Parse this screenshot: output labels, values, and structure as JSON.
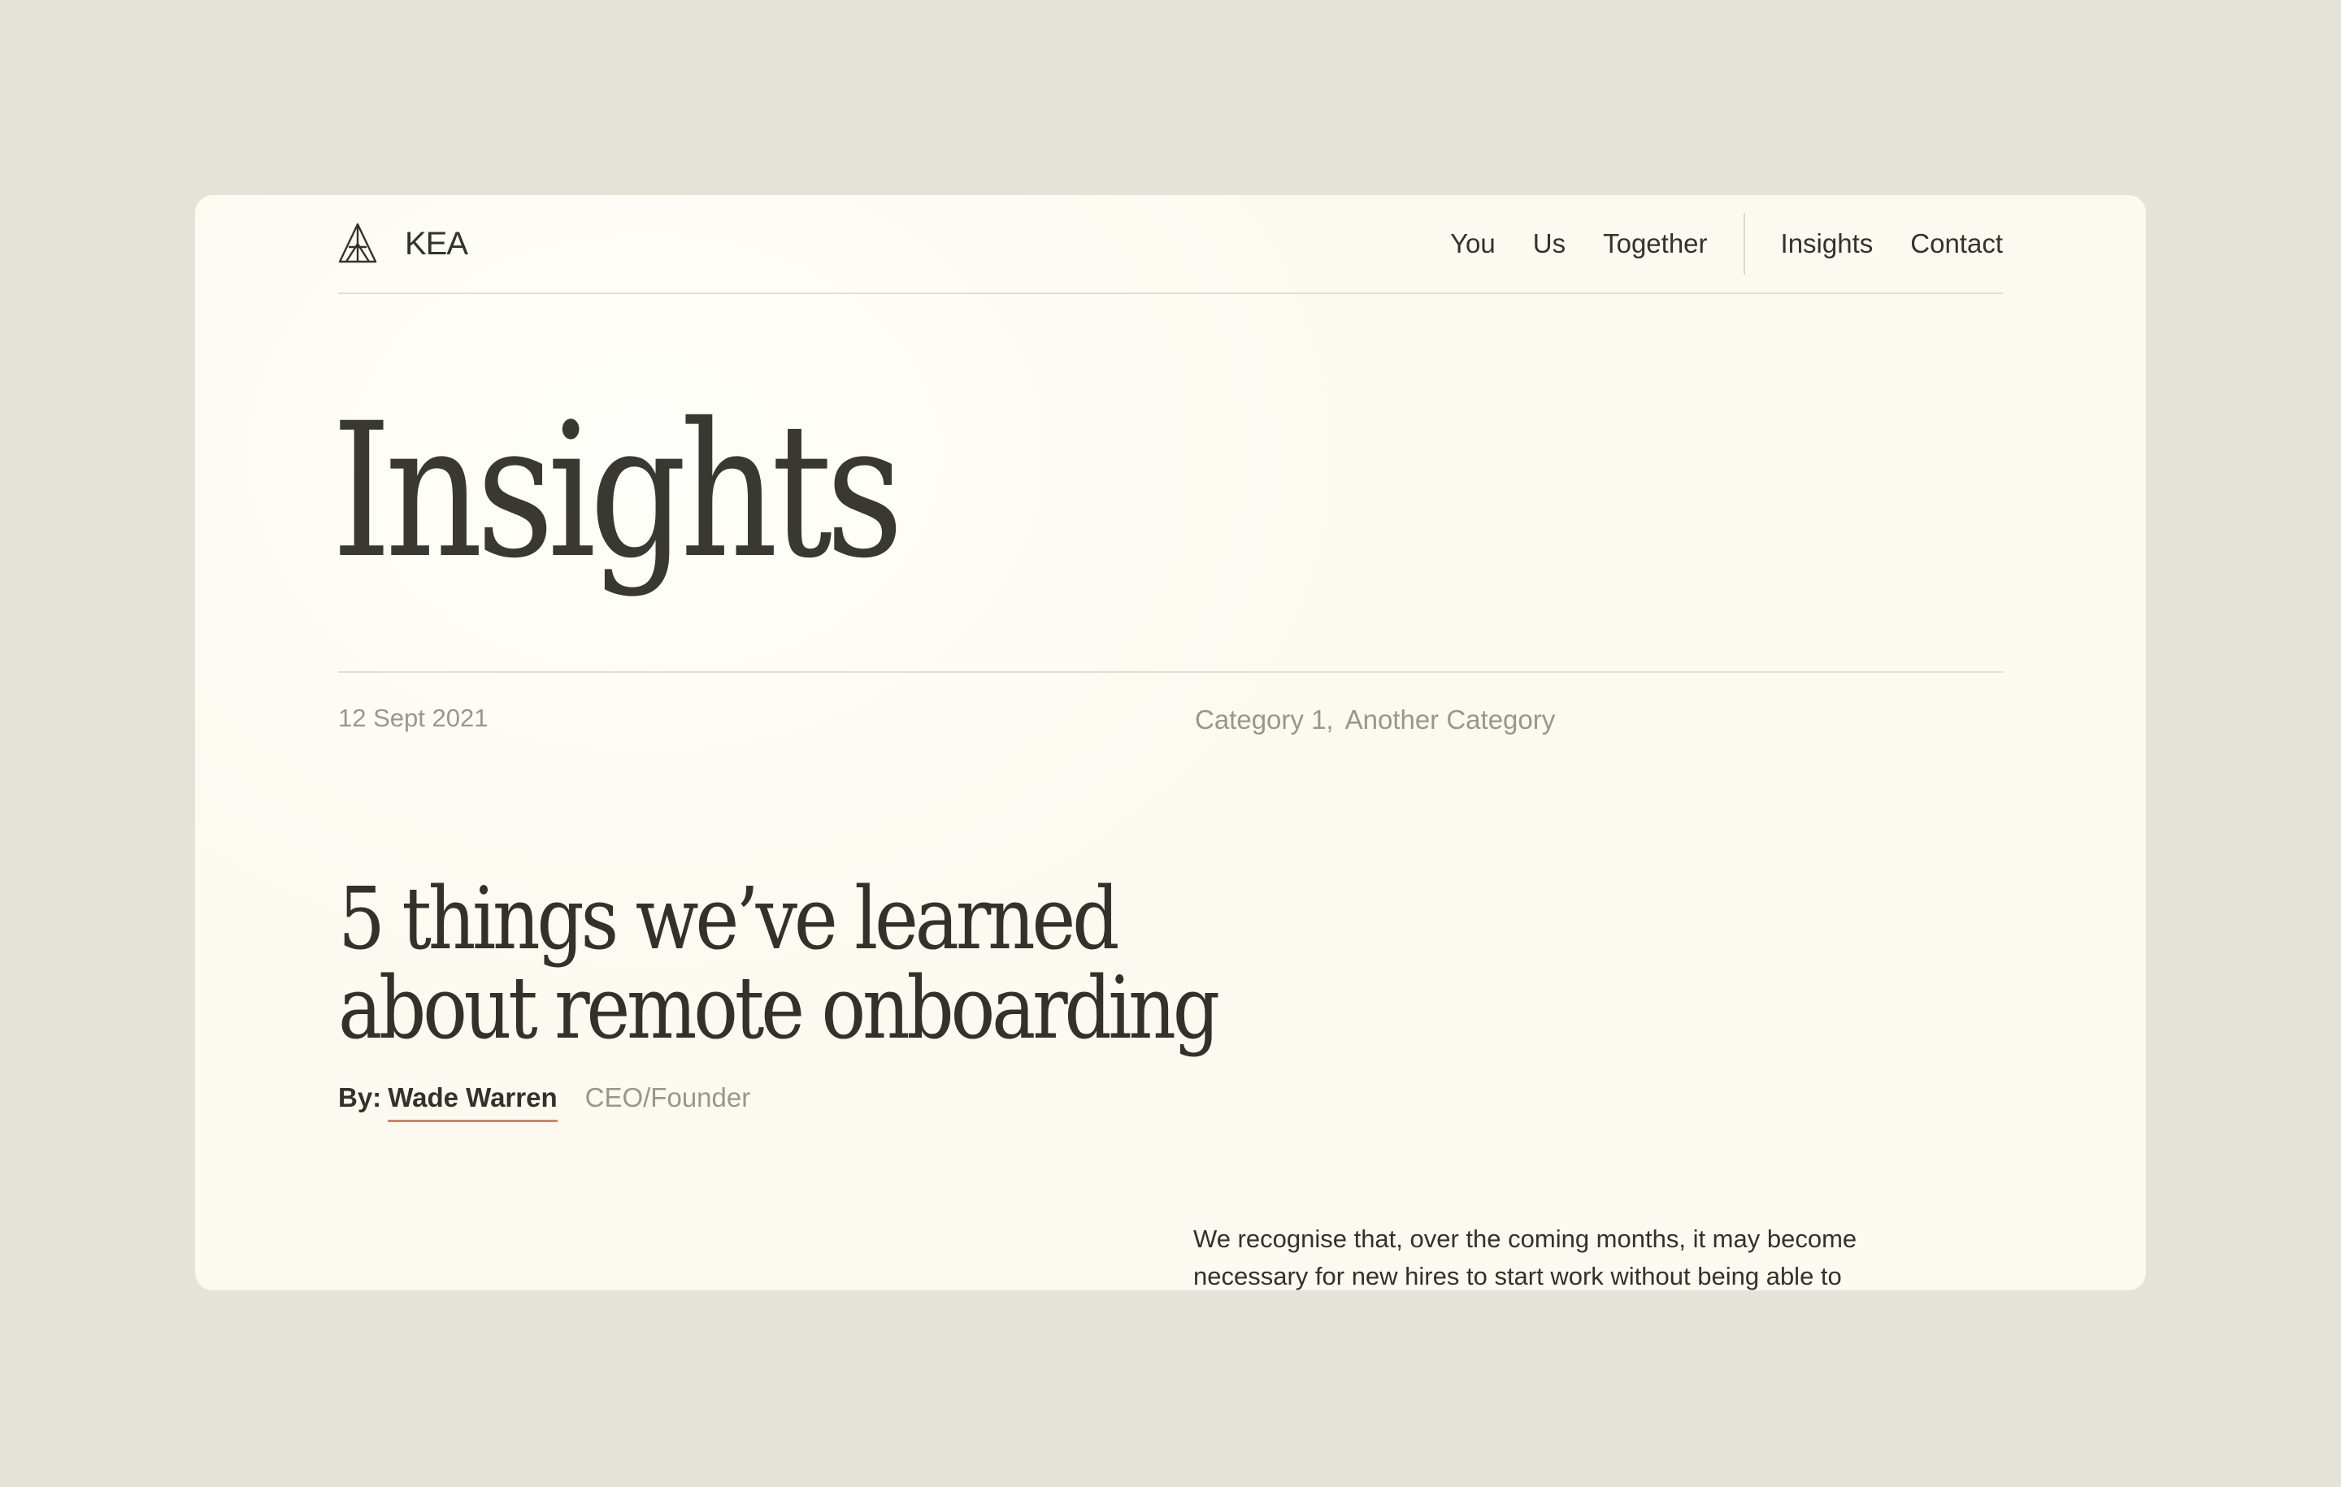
{
  "brand": {
    "logo_icon": "kea-triangle-logo",
    "name": "KEA"
  },
  "nav": {
    "items": [
      {
        "label": "You"
      },
      {
        "label": "Us"
      },
      {
        "label": "Together"
      },
      {
        "label": "Insights"
      },
      {
        "label": "Contact"
      }
    ]
  },
  "page": {
    "title": "Insights"
  },
  "post": {
    "date": "12 Sept 2021",
    "categories": [
      "Category 1,",
      "Another Category"
    ],
    "title_line1": "5 things we’ve learned",
    "title_line2": "about remote onboarding",
    "by_label": "By:",
    "author": "Wade Warren",
    "role": "CEO/Founder",
    "body_line1": "We recognise that, over the coming months, it may become",
    "body_line2": "necessary for new hires to start work without being able to"
  },
  "colors": {
    "background": "#e5e2da",
    "card": "#fcfaf0",
    "text": "#34322d",
    "muted": "#9a968c",
    "accent_underline": "#c9876f"
  }
}
